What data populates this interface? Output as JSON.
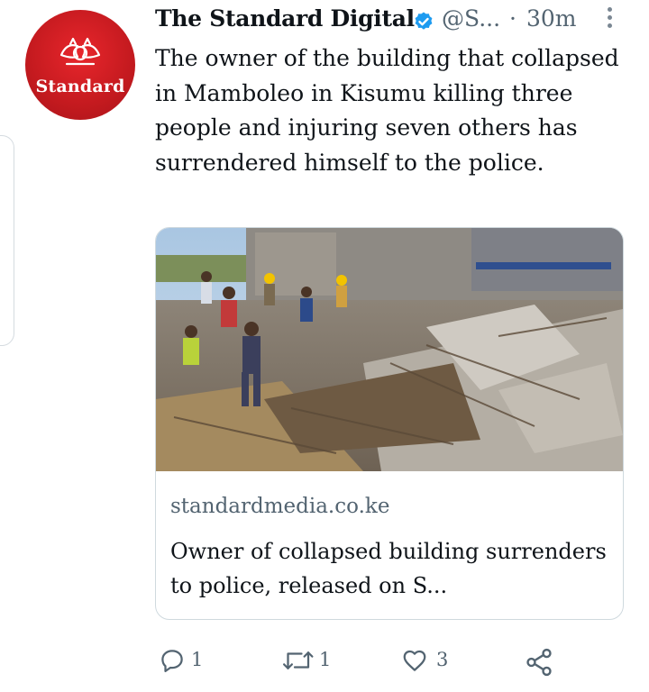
{
  "account": {
    "name": "The Standard Digital",
    "handle": "@S...",
    "separator": "·",
    "time": "30m",
    "avatar_text": "Standard",
    "brand_color": "#c41a1f",
    "verified_color": "#1d9bf0"
  },
  "tweet": {
    "text": "The owner of the building that collapsed in Mamboleo in Kisumu killing three people and injuring seven others has surrendered himself to the police."
  },
  "link_card": {
    "domain": "standardmedia.co.ke",
    "title": "Owner of collapsed building surrenders to police, released on S..."
  },
  "actions": {
    "reply_count": "1",
    "retweet_count": "1",
    "like_count": "3",
    "reply_icon": "reply-icon",
    "retweet_icon": "retweet-icon",
    "like_icon": "heart-icon",
    "share_icon": "share-icon"
  }
}
